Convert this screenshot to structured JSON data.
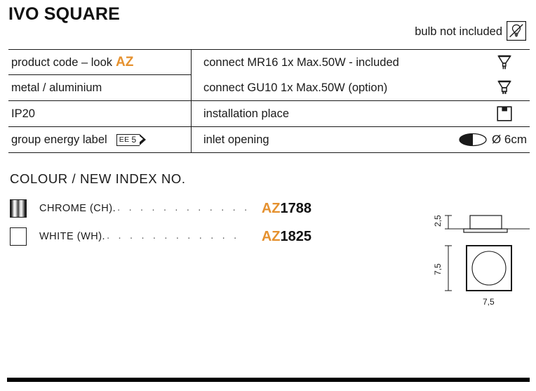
{
  "page_title": "IVO SQUARE",
  "bulb_note": {
    "label": "bulb not included",
    "icon": "bulb-crossed-out-icon"
  },
  "spec_table": {
    "rows": [
      {
        "left": "product code – look",
        "left_accent": "AZ",
        "right": "connect MR16 1x Max.50W - included",
        "icon": "mr16-lamp-icon"
      },
      {
        "left": "metal / aluminium",
        "right": "connect GU10 1x Max.50W (option)",
        "icon": "gu10-lamp-icon"
      },
      {
        "left": "IP20",
        "right": "installation place",
        "icon": "recessed-ceiling-icon"
      },
      {
        "left": "group energy label",
        "left_badge": {
          "prefix": "EE",
          "value": "5"
        },
        "right": "inlet opening",
        "icon": "inlet-opening-icon",
        "icon_text": "Ø 6cm"
      }
    ]
  },
  "colour_section": {
    "heading": "COLOUR / NEW INDEX NO.",
    "dots": ". . . . . . . . . . . .",
    "items": [
      {
        "swatch": "chrome-swatch",
        "name": "CHROME (CH).",
        "code_prefix": "AZ",
        "code_number": "1788"
      },
      {
        "swatch": "white-swatch",
        "name": "WHITE (WH).",
        "code_prefix": "AZ",
        "code_number": "1825"
      }
    ]
  },
  "technical_drawing": {
    "side_view_height": "2,5",
    "front_view_height": "7,5",
    "front_view_width": "7,5"
  },
  "colors": {
    "accent_orange": "#e5912f",
    "ink": "#1a1a1a",
    "background": "#ffffff"
  }
}
